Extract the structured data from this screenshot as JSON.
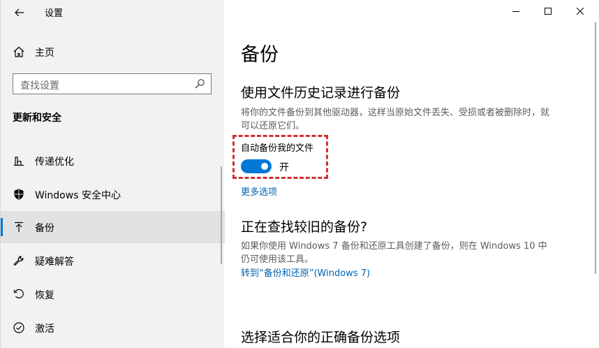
{
  "window": {
    "title": "设置",
    "back_icon": "arrow-left-icon",
    "controls": [
      "minimize-icon",
      "maximize-icon",
      "close-icon"
    ]
  },
  "sidebar": {
    "home_label": "主页",
    "search_placeholder": "查找设置",
    "section_title": "更新和安全",
    "items": [
      {
        "label": "传递优化",
        "icon": "delivery-optimization-icon"
      },
      {
        "label": "Windows 安全中心",
        "icon": "shield-icon"
      },
      {
        "label": "备份",
        "icon": "backup-arrow-icon",
        "selected": true
      },
      {
        "label": "疑难解答",
        "icon": "wrench-icon"
      },
      {
        "label": "恢复",
        "icon": "recovery-icon"
      },
      {
        "label": "激活",
        "icon": "activation-check-icon"
      }
    ]
  },
  "main": {
    "page_title": "备份",
    "file_history": {
      "heading": "使用文件历史记录进行备份",
      "description": "将你的文件备份到其他驱动器，这样当原始文件丢失、受损或者被删除时，就可以还原它们。",
      "toggle_label": "自动备份我的文件",
      "toggle_state": "开",
      "toggle_on": true,
      "more_options": "更多选项"
    },
    "older_backup": {
      "heading": "正在查找较旧的备份?",
      "description": "如果你使用 Windows 7 备份和还原工具创建了备份，则在 Windows 10 中仍可使用该工具。",
      "link": "转到“备份和还原”(Windows 7)"
    },
    "right_options": {
      "heading": "选择适合你的正确备份选项"
    }
  },
  "colors": {
    "accent": "#0078d7",
    "link": "#0063b1",
    "highlight": "#d0302c",
    "sidebar_bg": "#f2f2f2"
  }
}
